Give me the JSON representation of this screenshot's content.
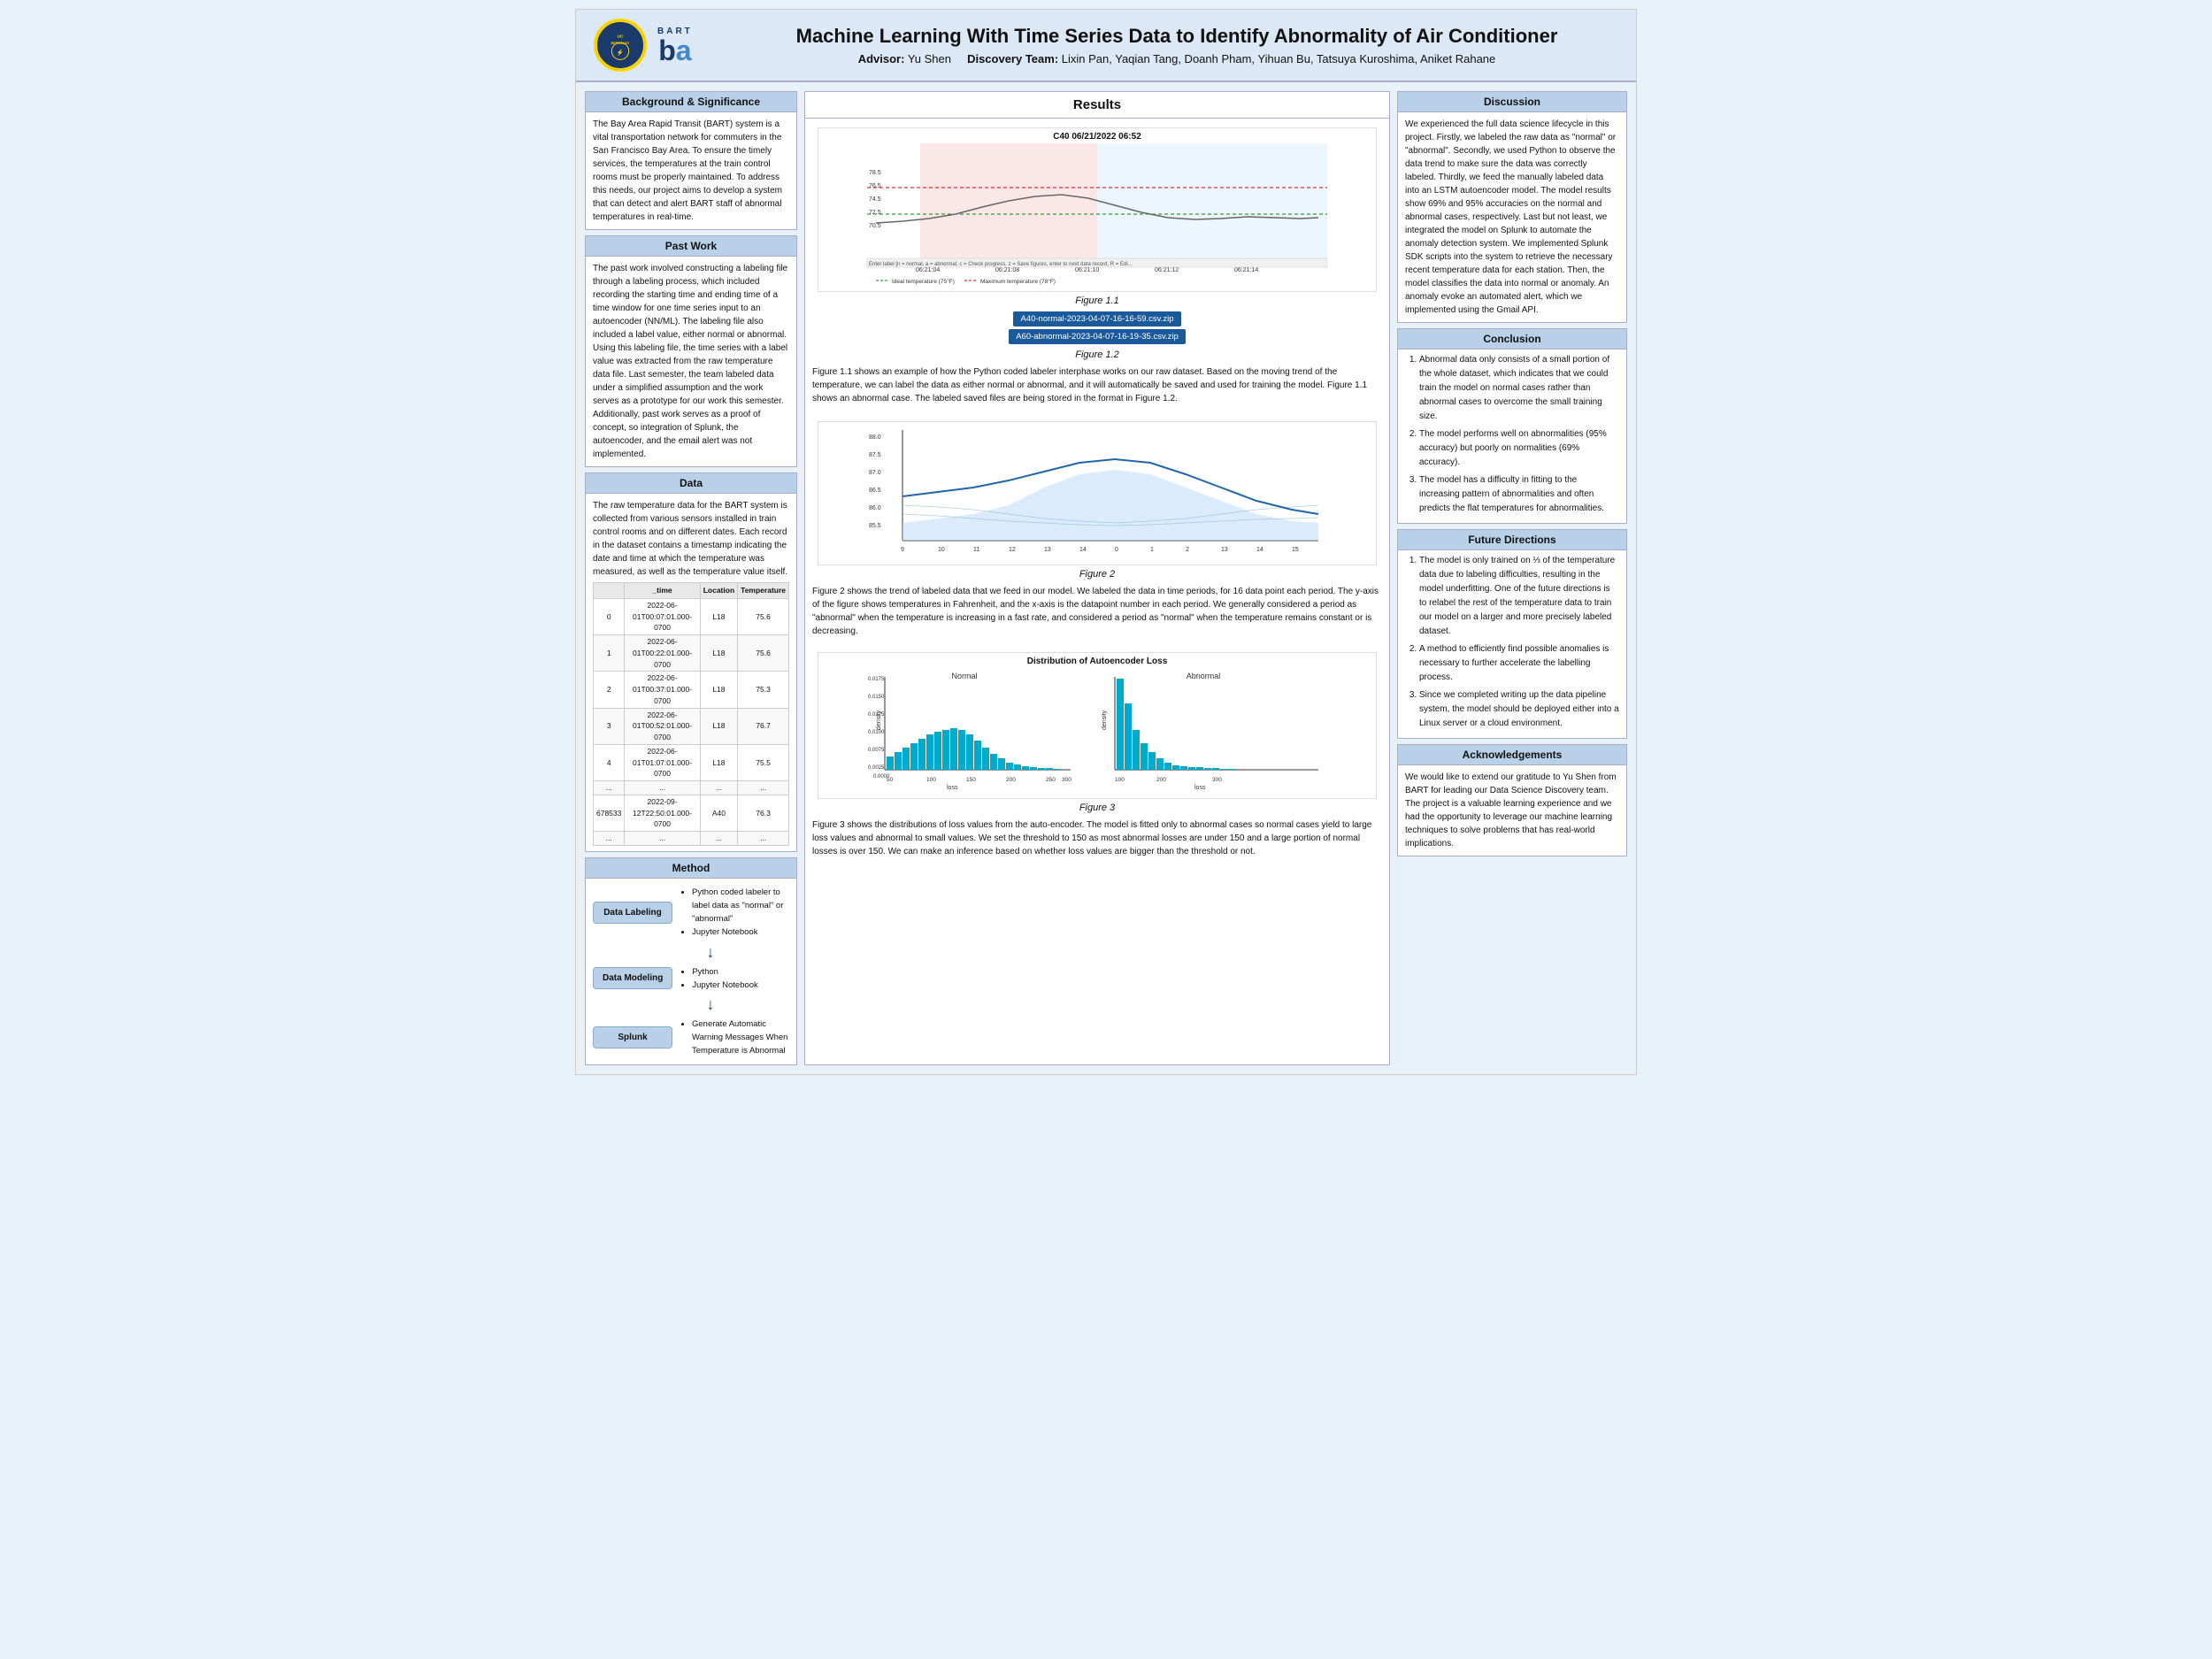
{
  "header": {
    "title": "Machine Learning With Time Series Data to Identify Abnormality of Air Conditioner",
    "advisor_label": "Advisor:",
    "advisor_name": "Yu Shen",
    "team_label": "Discovery Team:",
    "team_members": "Lixin Pan, Yaqian Tang, Doanh Pham, Yihuan Bu, Tatsuya Kuroshima, Aniket Rahane",
    "logo_circle_text": "UC BERKELEY",
    "bart_label": "BART"
  },
  "left": {
    "background_title": "Background & Significance",
    "background_text": "The Bay Area Rapid Transit (BART) system is a vital transportation network for commuters in the San Francisco Bay Area.  To ensure the timely services, the temperatures at the train control rooms must be properly maintained. To address this needs, our project aims to develop a system that can detect and alert BART staff of abnormal temperatures in real-time.",
    "past_work_title": "Past Work",
    "past_work_text": "The past work involved constructing a labeling file through a labeling process, which included recording the starting time and ending time of a time window for one time series input to an autoencoder (NN/ML). The labeling file also included a label value, either normal or abnormal. Using this labeling file, the time series with a label value was extracted from the raw temperature data file. Last semester, the team labeled data under a simplified assumption and the work serves as a prototype for our work this semester. Additionally, past work serves as a proof of concept, so integration of Splunk, the autoencoder, and the email alert was not implemented.",
    "data_title": "Data",
    "data_text": "The raw temperature data for the BART system is collected from various sensors installed in train control rooms and on different dates. Each record in the dataset contains a timestamp indicating the date and time at which the temperature was measured, as well as the temperature value itself.",
    "table_headers": [
      "",
      "_time",
      "Location",
      "Temperature"
    ],
    "table_rows": [
      [
        "0",
        "2022-06-01T00:07:01.000-0700",
        "L18",
        "75.6"
      ],
      [
        "1",
        "2022-06-01T00:22:01.000-0700",
        "L18",
        "75.6"
      ],
      [
        "2",
        "2022-06-01T00:37:01.000-0700",
        "L18",
        "75.3"
      ],
      [
        "3",
        "2022-06-01T00:52:01.000-0700",
        "L18",
        "76.7"
      ],
      [
        "4",
        "2022-06-01T01:07:01.000-0700",
        "L18",
        "75.5"
      ],
      [
        "...",
        "...",
        "...",
        "..."
      ],
      [
        "678533",
        "2022-09-12T22:50:01.000-0700",
        "A40",
        "76.3"
      ],
      [
        "...",
        "...",
        "...",
        "..."
      ]
    ],
    "method_title": "Method",
    "method_steps": [
      {
        "label": "Data Labeling",
        "bullets": [
          "Python coded labeler to label data as \"normal\" or \"abnormal\"",
          "Jupyter Notebook"
        ]
      },
      {
        "label": "Data Modeling",
        "bullets": [
          "Python",
          "Jupyter Notebook"
        ]
      },
      {
        "label": "Splunk",
        "bullets": [
          "Generate Automatic Warning Messages When Temperature is Abnormal"
        ]
      }
    ]
  },
  "results": {
    "title": "Results",
    "fig1_title": "C40 06/21/2022 06:52",
    "fig1_caption": "Figure 1.1",
    "fig12_caption": "Figure 1.2",
    "csv_links": [
      "A40-normal-2023-04-07-16-16-59.csv.zip",
      "A60-abnormal-2023-04-07-16-19-35.csv.zip"
    ],
    "fig1_desc": "Figure 1.1 shows an example of how the Python coded labeler interphase works on our raw dataset. Based on the moving trend of the temperature, we can label the data as either normal or abnormal, and it will automatically be saved and used for training the model. Figure 1.1 shows an abnormal case. The labeled saved files are being stored in the format in Figure 1.2.",
    "fig2_caption": "Figure 2",
    "fig2_desc": "Figure 2 shows the trend of labeled data that we feed in our model. We labeled the data in time periods, for 16 data point each period. The y-axis of the figure shows temperatures in Fahrenheit, and the x-axis is the datapoint number in each period. We generally considered a period as \"abnormal\" when the temperature is increasing in a fast rate, and considered a period as \"normal\" when the temperature remains constant or is decreasing.",
    "fig3_caption": "Figure 3",
    "fig3_desc": "Figure 3 shows the distributions of loss values from the auto-encoder. The model is fitted only to abnormal cases so normal cases yield to large loss values and abnormal to small values. We set the threshold to 150 as most abnormal losses are under 150 and a large portion of normal losses is over 150. We can make an inference based on whether loss values are bigger than the threshold or not."
  },
  "discussion": {
    "title": "Discussion",
    "text": "We experienced the full data science lifecycle in this project. Firstly, we labeled the raw data as \"normal\" or \"abnormal\". Secondly, we used Python to observe the data trend to make sure the data was correctly labeled. Thirdly, we feed the manually labeled data into an LSTM autoencoder model. The model results show 69% and 95% accuracies on the normal and abnormal cases, respectively. Last but not least, we integrated the model on Splunk to automate the anomaly detection system. We implemented Splunk SDK scripts into the system to retrieve the necessary recent temperature data for each station. Then, the model classifies the data into normal or anomaly. An anomaly evoke an automated alert, which we implemented using the Gmail API.",
    "conclusion_title": "Conclusion",
    "conclusion_items": [
      "Abnormal data only consists of a small portion of the whole dataset, which indicates that we could train the model on normal cases rather than abnormal cases to overcome the small training size.",
      "The model performs well on abnormalities (95% accuracy) but poorly on normalities (69% accuracy).",
      "The model has a difficulty in fitting to the increasing pattern of abnormalities and often predicts the flat temperatures for abnormalities."
    ],
    "future_title": "Future Directions",
    "future_items": [
      "The model is only trained on ⅓ of the temperature data due to labeling difficulties, resulting in the model underfitting. One of the future directions is to relabel the rest of the temperature data to train our model on a larger and more precisely labeled dataset.",
      "A method to efficiently find possible anomalies is necessary to further accelerate the labelling process.",
      "Since we completed writing up the data pipeline system, the model should be deployed either into a Linux server or a cloud environment."
    ],
    "ack_title": "Acknowledgements",
    "ack_text": "We would like to extend our gratitude to Yu Shen from BART for leading our Data Science Discovery team. The project is a valuable learning experience and we had the opportunity to leverage our machine learning techniques to solve problems that has real-world implications."
  }
}
